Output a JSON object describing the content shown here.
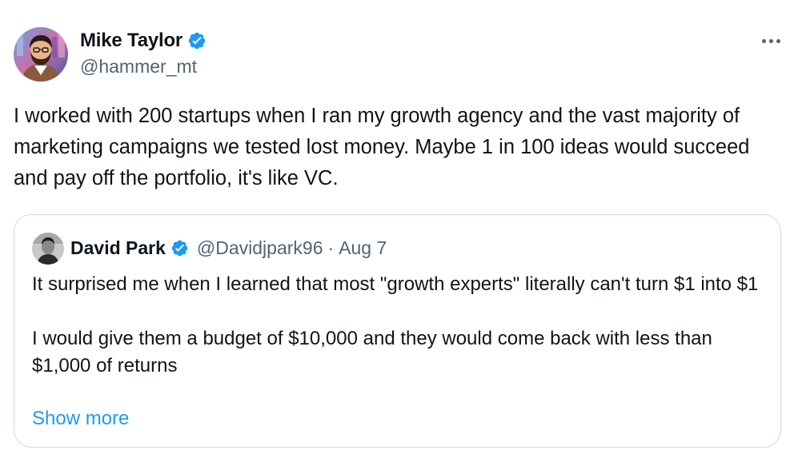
{
  "author": {
    "display_name": "Mike Taylor",
    "handle": "@hammer_mt",
    "verified": true
  },
  "tweet": {
    "text": "I worked with 200 startups when I ran my growth agency and the vast majority of marketing campaigns we tested lost money. Maybe 1 in 100 ideas would succeed and pay off the portfolio, it's like VC."
  },
  "quoted_tweet": {
    "display_name": "David Park",
    "handle": "@Davidjpark96",
    "separator": "·",
    "date": "Aug 7",
    "verified": true,
    "text": "It surprised me when I learned that most \"growth experts\" literally can't turn $1 into $1\n\nI would give them a budget of $10,000 and they would come back with less than $1,000 of returns",
    "show_more_label": "Show more"
  },
  "icons": {
    "verified": "verified-badge-icon",
    "more": "more-options-icon"
  },
  "colors": {
    "text_primary": "#0f1419",
    "text_secondary": "#536471",
    "accent": "#1d9bf0",
    "border": "#cfd9de"
  }
}
